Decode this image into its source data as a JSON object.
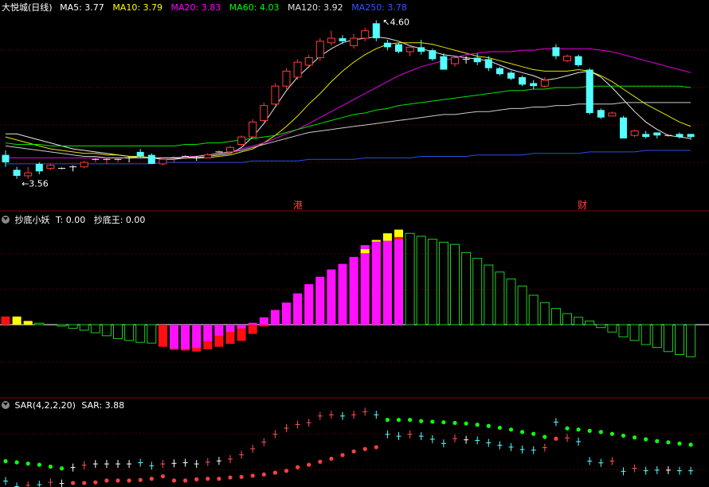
{
  "main": {
    "title": "大悦城(日线)",
    "ma": [
      {
        "label": "MA5: 3.77",
        "color": "#ffffff"
      },
      {
        "label": "MA10: 3.79",
        "color": "#ffff00"
      },
      {
        "label": "MA20: 3.83",
        "color": "#ff00ff"
      },
      {
        "label": "MA60: 4.03",
        "color": "#00ff00"
      },
      {
        "label": "MA120: 3.92",
        "color": "#e0e0e0"
      },
      {
        "label": "MA250: 3.78",
        "color": "#3355ff"
      }
    ],
    "high_label": "4.60",
    "low_label": "3.56",
    "markers": [
      "港",
      "财"
    ]
  },
  "ind1": {
    "title": "抄底小妖",
    "values": [
      {
        "label": "T: 0.00",
        "color": "#ffffff"
      },
      {
        "label": "抄底王: 0.00",
        "color": "#ffffff"
      }
    ]
  },
  "sar": {
    "title": "SAR(4,2,2,20)",
    "values": [
      {
        "label": "SAR: 3.88",
        "color": "#ffffff"
      }
    ]
  },
  "chart_data": [
    {
      "type": "candlestick",
      "title": "大悦城(日线)",
      "ylim": [
        3.5,
        4.66
      ],
      "candles": [
        [
          3.72,
          3.67,
          3.75,
          3.64
        ],
        [
          3.62,
          3.58,
          3.64,
          3.56
        ],
        [
          3.58,
          3.6,
          3.64,
          3.56
        ],
        [
          3.66,
          3.61,
          3.67,
          3.59
        ],
        [
          3.63,
          3.65,
          3.66,
          3.62
        ],
        [
          3.63,
          3.63,
          3.64,
          3.62
        ],
        [
          3.64,
          3.63,
          3.65,
          3.61
        ],
        [
          3.64,
          3.67,
          3.68,
          3.63
        ],
        [
          3.69,
          3.69,
          3.7,
          3.67
        ],
        [
          3.69,
          3.69,
          3.7,
          3.66
        ],
        [
          3.69,
          3.69,
          3.7,
          3.67
        ],
        [
          3.7,
          3.69,
          3.71,
          3.67
        ],
        [
          3.74,
          3.71,
          3.76,
          3.7
        ],
        [
          3.72,
          3.66,
          3.73,
          3.66
        ],
        [
          3.66,
          3.69,
          3.7,
          3.65
        ],
        [
          3.69,
          3.7,
          3.71,
          3.67
        ],
        [
          3.7,
          3.71,
          3.72,
          3.69
        ],
        [
          3.7,
          3.69,
          3.71,
          3.68
        ],
        [
          3.7,
          3.72,
          3.73,
          3.7
        ],
        [
          3.73,
          3.74,
          3.75,
          3.72
        ],
        [
          3.74,
          3.77,
          3.78,
          3.73
        ],
        [
          3.79,
          3.84,
          3.85,
          3.78
        ],
        [
          3.84,
          3.94,
          3.96,
          3.83
        ],
        [
          3.95,
          4.05,
          4.07,
          3.94
        ],
        [
          4.06,
          4.18,
          4.2,
          4.05
        ],
        [
          4.18,
          4.28,
          4.3,
          4.16
        ],
        [
          4.24,
          4.34,
          4.36,
          4.22
        ],
        [
          4.32,
          4.37,
          4.39,
          4.3
        ],
        [
          4.37,
          4.48,
          4.5,
          4.35
        ],
        [
          4.47,
          4.5,
          4.55,
          4.45
        ],
        [
          4.5,
          4.48,
          4.52,
          4.46
        ],
        [
          4.45,
          4.5,
          4.53,
          4.43
        ],
        [
          4.5,
          4.55,
          4.57,
          4.48
        ],
        [
          4.6,
          4.5,
          4.62,
          4.48
        ],
        [
          4.47,
          4.44,
          4.49,
          4.42
        ],
        [
          4.46,
          4.41,
          4.47,
          4.4
        ],
        [
          4.41,
          4.44,
          4.44,
          4.38
        ],
        [
          4.44,
          4.41,
          4.49,
          4.39
        ],
        [
          4.42,
          4.36,
          4.43,
          4.35
        ],
        [
          4.38,
          4.29,
          4.4,
          4.29
        ],
        [
          4.33,
          4.37,
          4.38,
          4.31
        ],
        [
          4.36,
          4.35,
          4.38,
          4.33
        ],
        [
          4.37,
          4.34,
          4.4,
          4.32
        ],
        [
          4.36,
          4.3,
          4.38,
          4.28
        ],
        [
          4.3,
          4.26,
          4.31,
          4.25
        ],
        [
          4.27,
          4.23,
          4.28,
          4.22
        ],
        [
          4.24,
          4.19,
          4.25,
          4.18
        ],
        [
          4.2,
          4.18,
          4.22,
          4.16
        ],
        [
          4.18,
          4.22,
          4.24,
          4.17
        ],
        [
          4.44,
          4.38,
          4.46,
          4.36
        ],
        [
          4.35,
          4.38,
          4.39,
          4.34
        ],
        [
          4.38,
          4.32,
          4.39,
          4.31
        ],
        [
          4.29,
          4.0,
          4.3,
          3.99
        ],
        [
          4.02,
          3.97,
          4.03,
          3.96
        ],
        [
          3.98,
          4.0,
          4.01,
          3.98
        ],
        [
          3.97,
          3.83,
          3.98,
          3.83
        ],
        [
          3.85,
          3.88,
          3.89,
          3.84
        ],
        [
          3.86,
          3.84,
          3.88,
          3.83
        ],
        [
          3.87,
          3.85,
          3.87,
          3.83
        ],
        [
          3.85,
          3.85,
          3.86,
          3.84
        ],
        [
          3.86,
          3.84,
          3.87,
          3.83
        ],
        [
          3.86,
          3.84,
          3.86,
          3.82
        ]
      ],
      "moving_averages": [
        {
          "name": "MA5",
          "values": [
            3.86,
            3.86,
            3.84,
            3.82,
            3.8,
            3.78,
            3.76,
            3.75,
            3.74,
            3.73,
            3.72,
            3.71,
            3.7,
            3.7,
            3.69,
            3.69,
            3.7,
            3.7,
            3.71,
            3.72,
            3.73,
            3.77,
            3.84,
            3.93,
            4.04,
            4.15,
            4.24,
            4.31,
            4.38,
            4.43,
            4.47,
            4.49,
            4.5,
            4.51,
            4.5,
            4.48,
            4.45,
            4.43,
            4.41,
            4.39,
            4.38,
            4.37,
            4.36,
            4.35,
            4.32,
            4.29,
            4.27,
            4.25,
            4.22,
            4.23,
            4.25,
            4.27,
            4.28,
            4.24,
            4.17,
            4.09,
            4.01,
            3.94,
            3.89,
            3.85,
            3.84,
            3.83
          ]
        },
        {
          "name": "MA10",
          "values": [
            3.84,
            3.82,
            3.8,
            3.78,
            3.76,
            3.75,
            3.74,
            3.73,
            3.73,
            3.72,
            3.72,
            3.71,
            3.71,
            3.7,
            3.7,
            3.7,
            3.7,
            3.7,
            3.7,
            3.71,
            3.72,
            3.74,
            3.76,
            3.8,
            3.85,
            3.91,
            3.98,
            4.06,
            4.13,
            4.21,
            4.28,
            4.34,
            4.39,
            4.43,
            4.46,
            4.47,
            4.47,
            4.47,
            4.46,
            4.44,
            4.42,
            4.4,
            4.38,
            4.37,
            4.35,
            4.33,
            4.31,
            4.29,
            4.28,
            4.28,
            4.28,
            4.29,
            4.28,
            4.25,
            4.21,
            4.16,
            4.11,
            4.06,
            4.02,
            3.98,
            3.94,
            3.91
          ]
        },
        {
          "name": "MA20",
          "values": [
            3.7,
            3.7,
            3.7,
            3.7,
            3.7,
            3.7,
            3.7,
            3.7,
            3.7,
            3.7,
            3.7,
            3.7,
            3.7,
            3.7,
            3.7,
            3.7,
            3.71,
            3.71,
            3.72,
            3.73,
            3.74,
            3.76,
            3.78,
            3.8,
            3.83,
            3.86,
            3.89,
            3.93,
            3.97,
            4.01,
            4.05,
            4.09,
            4.13,
            4.17,
            4.21,
            4.25,
            4.28,
            4.31,
            4.33,
            4.35,
            4.37,
            4.39,
            4.4,
            4.41,
            4.41,
            4.41,
            4.42,
            4.42,
            4.43,
            4.43,
            4.43,
            4.43,
            4.43,
            4.42,
            4.41,
            4.39,
            4.37,
            4.35,
            4.33,
            4.31,
            4.29,
            4.27
          ]
        },
        {
          "name": "MA60",
          "values": [
            3.8,
            3.79,
            3.79,
            3.79,
            3.78,
            3.78,
            3.78,
            3.78,
            3.78,
            3.78,
            3.78,
            3.78,
            3.78,
            3.78,
            3.78,
            3.78,
            3.79,
            3.79,
            3.8,
            3.8,
            3.81,
            3.82,
            3.83,
            3.84,
            3.85,
            3.87,
            3.89,
            3.91,
            3.93,
            3.95,
            3.97,
            3.99,
            4.0,
            4.02,
            4.03,
            4.05,
            4.06,
            4.07,
            4.08,
            4.09,
            4.1,
            4.11,
            4.12,
            4.13,
            4.14,
            4.15,
            4.15,
            4.16,
            4.16,
            4.17,
            4.17,
            4.17,
            4.18,
            4.18,
            4.18,
            4.18,
            4.18,
            4.18,
            4.18,
            4.18,
            4.18,
            4.17
          ]
        },
        {
          "name": "MA120",
          "values": [
            3.78,
            3.77,
            3.76,
            3.75,
            3.74,
            3.73,
            3.72,
            3.71,
            3.71,
            3.7,
            3.7,
            3.7,
            3.7,
            3.7,
            3.7,
            3.7,
            3.7,
            3.71,
            3.72,
            3.73,
            3.74,
            3.75,
            3.77,
            3.79,
            3.81,
            3.83,
            3.85,
            3.87,
            3.88,
            3.89,
            3.9,
            3.91,
            3.92,
            3.93,
            3.94,
            3.95,
            3.96,
            3.97,
            3.98,
            3.99,
            3.99,
            4.0,
            4.01,
            4.01,
            4.02,
            4.03,
            4.03,
            4.04,
            4.04,
            4.05,
            4.05,
            4.06,
            4.06,
            4.06,
            4.06,
            4.07,
            4.07,
            4.07,
            4.07,
            4.07,
            4.07,
            4.07
          ]
        },
        {
          "name": "MA250",
          "values": [
            3.66,
            3.66,
            3.66,
            3.66,
            3.66,
            3.66,
            3.66,
            3.66,
            3.66,
            3.66,
            3.66,
            3.66,
            3.66,
            3.66,
            3.67,
            3.67,
            3.67,
            3.67,
            3.67,
            3.67,
            3.67,
            3.67,
            3.68,
            3.68,
            3.68,
            3.68,
            3.68,
            3.69,
            3.69,
            3.69,
            3.69,
            3.69,
            3.7,
            3.7,
            3.7,
            3.7,
            3.7,
            3.71,
            3.71,
            3.71,
            3.71,
            3.71,
            3.72,
            3.72,
            3.72,
            3.72,
            3.72,
            3.73,
            3.73,
            3.73,
            3.73,
            3.73,
            3.74,
            3.74,
            3.74,
            3.74,
            3.74,
            3.75,
            3.75,
            3.75,
            3.75,
            3.75
          ]
        }
      ]
    },
    {
      "type": "bar",
      "title": "抄底小妖",
      "zero_line": true,
      "ylim": [
        -1.12,
        2.78
      ],
      "values": [
        0.22,
        0.22,
        0.1,
        0.04,
        0.0,
        -0.04,
        -0.1,
        -0.15,
        -0.22,
        -0.3,
        -0.38,
        -0.43,
        -0.48,
        -0.5,
        -0.6,
        -0.68,
        -0.7,
        -0.73,
        -0.67,
        -0.6,
        -0.52,
        -0.44,
        -0.25,
        -0.05,
        0.2,
        0.45,
        0.72,
        0.98,
        1.2,
        1.42,
        1.58,
        1.78,
        2.05,
        2.3,
        2.48,
        2.58,
        2.48,
        2.4,
        2.32,
        2.24,
        2.18,
        1.96,
        1.8,
        1.62,
        1.43,
        1.24,
        1.05,
        0.8,
        0.6,
        0.44,
        0.3,
        0.2,
        0.1,
        -0.08,
        -0.2,
        -0.33,
        -0.43,
        -0.54,
        -0.62,
        -0.73,
        -0.81,
        -0.87
      ],
      "magenta": [
        0,
        0,
        0,
        0,
        0,
        0,
        0,
        0,
        0,
        0,
        0,
        0,
        0,
        0,
        0,
        -0.65,
        -0.66,
        -0.63,
        -0.45,
        -0.3,
        -0.2,
        -0.1,
        0.05,
        0.2,
        0.4,
        0.6,
        0.85,
        1.1,
        1.3,
        1.5,
        1.65,
        1.84,
        2.16,
        2.26,
        2.28,
        2.32,
        0,
        0,
        0,
        0,
        0,
        0,
        0,
        0,
        0,
        0,
        0,
        0,
        0,
        0,
        0,
        0,
        0,
        0,
        0,
        0,
        0,
        0,
        0,
        0,
        0,
        0
      ],
      "yellow_tops": [
        0.22,
        0.22,
        0.1,
        0,
        0,
        0,
        0,
        0,
        0,
        0,
        0,
        0,
        0,
        0,
        0,
        0,
        0,
        0,
        0,
        0,
        0,
        0,
        0,
        0,
        0,
        0,
        0,
        0,
        0,
        0,
        0,
        0,
        2.45,
        2.52,
        2.58,
        2.48,
        0,
        0,
        0,
        0,
        0,
        0,
        0,
        0,
        0,
        0,
        0,
        0,
        0,
        0,
        0,
        0,
        0,
        0,
        0,
        0,
        0,
        0,
        0,
        0,
        0,
        0
      ]
    },
    {
      "type": "scatter",
      "title": "SAR(4,2,2,20)",
      "ylim": [
        3.52,
        4.7
      ],
      "sar": [
        3.92,
        3.9,
        3.88,
        3.86,
        3.83,
        3.8,
        3.56,
        3.56,
        3.57,
        3.6,
        3.6,
        3.6,
        3.61,
        3.63,
        3.67,
        3.6,
        3.6,
        3.62,
        3.63,
        3.63,
        3.65,
        3.66,
        3.68,
        3.7,
        3.73,
        3.76,
        3.82,
        3.86,
        3.91,
        3.96,
        4.02,
        4.08,
        4.12,
        4.15,
        4.6,
        4.6,
        4.6,
        4.58,
        4.57,
        4.56,
        4.55,
        4.54,
        4.52,
        4.5,
        4.47,
        4.44,
        4.4,
        4.37,
        4.32,
        4.29,
        4.46,
        4.44,
        4.42,
        4.4,
        4.37,
        4.34,
        4.31,
        4.28,
        4.25,
        4.23,
        4.21,
        4.19
      ]
    }
  ]
}
